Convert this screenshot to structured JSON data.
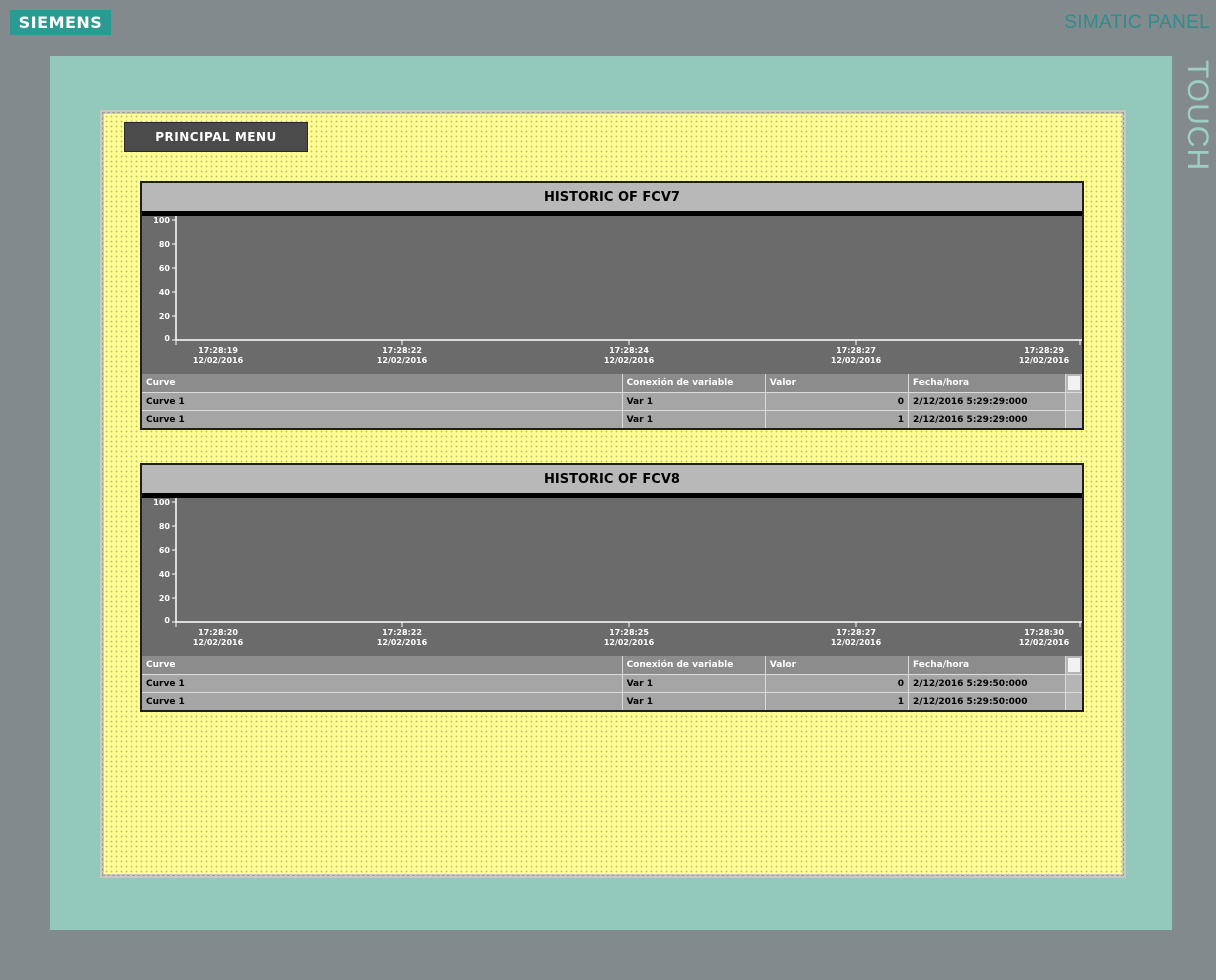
{
  "device": {
    "logo": "SIEMENS",
    "brand": "SIMATIC PANEL",
    "touch": "TOUCH"
  },
  "menu_button": {
    "label": "PRINCIPAL MENU"
  },
  "trends": [
    {
      "title": "HISTORIC OF FCV7",
      "y_ticks": [
        "100",
        "80",
        "60",
        "40",
        "20",
        "0"
      ],
      "x_ticks": [
        {
          "time": "17:28:19",
          "date": "12/02/2016"
        },
        {
          "time": "17:28:22",
          "date": "12/02/2016"
        },
        {
          "time": "17:28:24",
          "date": "12/02/2016"
        },
        {
          "time": "17:28:27",
          "date": "12/02/2016"
        },
        {
          "time": "17:28:29",
          "date": "12/02/2016"
        }
      ],
      "legend_headers": [
        "Curve",
        "Conexión de variable",
        "Valor",
        "Fecha/hora"
      ],
      "legend_rows": [
        {
          "curve": "Curve 1",
          "tag": "Var 1",
          "value": "0",
          "datetime": "2/12/2016 5:29:29:000"
        },
        {
          "curve": "Curve 1",
          "tag": "Var 1",
          "value": "1",
          "datetime": "2/12/2016 5:29:29:000"
        }
      ]
    },
    {
      "title": "HISTORIC OF FCV8",
      "y_ticks": [
        "100",
        "80",
        "60",
        "40",
        "20",
        "0"
      ],
      "x_ticks": [
        {
          "time": "17:28:20",
          "date": "12/02/2016"
        },
        {
          "time": "17:28:22",
          "date": "12/02/2016"
        },
        {
          "time": "17:28:25",
          "date": "12/02/2016"
        },
        {
          "time": "17:28:27",
          "date": "12/02/2016"
        },
        {
          "time": "17:28:30",
          "date": "12/02/2016"
        }
      ],
      "legend_headers": [
        "Curve",
        "Conexión de variable",
        "Valor",
        "Fecha/hora"
      ],
      "legend_rows": [
        {
          "curve": "Curve 1",
          "tag": "Var 1",
          "value": "0",
          "datetime": "2/12/2016 5:29:50:000"
        },
        {
          "curve": "Curve 1",
          "tag": "Var 1",
          "value": "1",
          "datetime": "2/12/2016 5:29:50:000"
        }
      ]
    }
  ],
  "colors": {
    "panel_frame": "#838a8d",
    "bezel": "#93c9bb",
    "screen_bg": "#ffff94",
    "trend_bg": "#6b6b6b",
    "axis": "#ffffff"
  }
}
